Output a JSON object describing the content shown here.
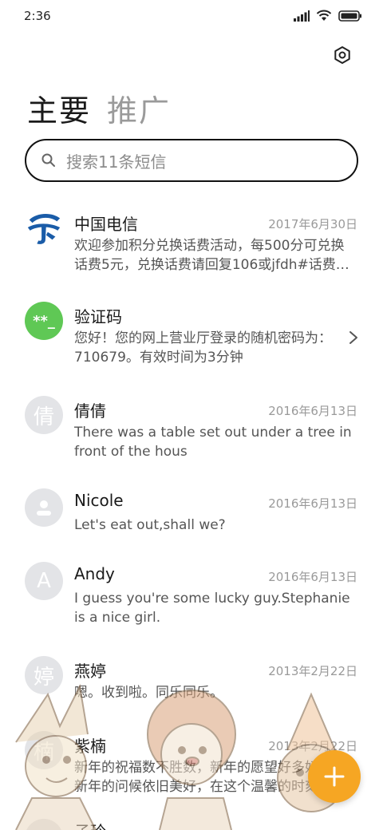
{
  "status_bar": {
    "time": "2:36"
  },
  "tabs": [
    {
      "label": "主要"
    },
    {
      "label": "推广"
    }
  ],
  "search": {
    "placeholder": "搜索11条短信"
  },
  "conversations": [
    {
      "name": "中国电信",
      "date": "2017年6月30日",
      "preview": "欢迎参加积分兑换话费活动，每500分可兑换话费5元，兑换话费请回复106或jfdh#话费…",
      "avatar": "china-telecom-logo"
    },
    {
      "name": "验证码",
      "date": "",
      "preview": "您好！您的网上营业厅登录的随机密码为：710679。有效时间为3分钟",
      "avatar_text": "**_"
    },
    {
      "name": "倩倩",
      "date": "2016年6月13日",
      "preview": "There was a table set out under a tree in front of the hous",
      "avatar_text": "倩"
    },
    {
      "name": "Nicole",
      "date": "2016年6月13日",
      "preview": "Let's eat out,shall we?",
      "avatar": "person-icon"
    },
    {
      "name": "Andy",
      "date": "2016年6月13日",
      "preview": "I guess you're some lucky guy.Stephanie is a nice girl.",
      "avatar_text": "A"
    },
    {
      "name": "燕婷",
      "date": "2013年2月22日",
      "preview": "嗯。收到啦。同乐同乐。",
      "avatar_text": "婷"
    },
    {
      "name": "紫楠",
      "date": "2013年2月22日",
      "preview": "新年的祝福数不胜数，新年的愿望好多好多，新年的问候依旧美好，在这个温馨的时刻",
      "avatar_text": "楠"
    },
    {
      "name": "子玲",
      "date": "",
      "preview": "",
      "avatar_text": ""
    }
  ],
  "colors": {
    "accent": "#f6a623",
    "green_avatar": "#5fc855",
    "telecom_blue": "#1a5ca8"
  }
}
